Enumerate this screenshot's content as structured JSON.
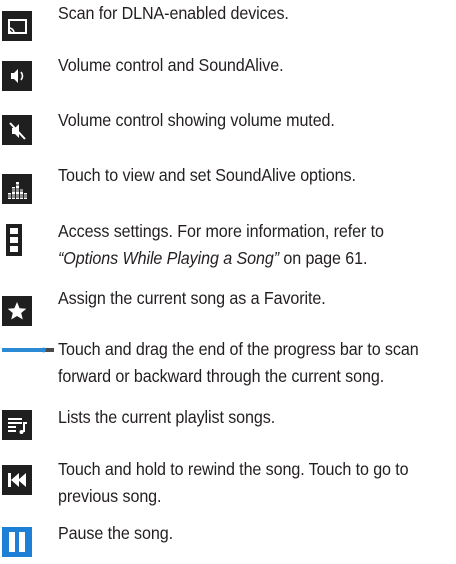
{
  "items": [
    {
      "icon": "screen-share-icon",
      "text": "Scan for DLNA-enabled devices."
    },
    {
      "icon": "volume-icon",
      "text": "Volume control and SoundAlive."
    },
    {
      "icon": "volume-muted-icon",
      "text": "Volume control showing volume muted."
    },
    {
      "icon": "equalizer-icon",
      "text": "Touch to view and set SoundAlive options."
    },
    {
      "icon": "menu-dots-icon",
      "text_line1": "Access settings. For more information, refer to",
      "text_line2_italic": "“Options While Playing a Song”",
      "text_line2_rest": " on page 61."
    },
    {
      "icon": "star-icon",
      "text": "Assign the current song as a Favorite."
    },
    {
      "icon": "progress-bar-icon",
      "text_line1": "Touch and drag the end of the progress bar to scan",
      "text_line2": "forward or backward through the current song.",
      "progress": 0.8
    },
    {
      "icon": "playlist-icon",
      "text": "Lists the current playlist songs."
    },
    {
      "icon": "rewind-icon",
      "text_line1": "Touch and hold to rewind the song. Touch to go to",
      "text_line2": "previous song."
    },
    {
      "icon": "pause-icon",
      "text": "Pause the song."
    }
  ],
  "colors": {
    "icon_bg": "#1f1f1f",
    "pause_blue": "#1d7fd6",
    "progress_blue": "#2a8ad4",
    "text": "#231f20"
  }
}
